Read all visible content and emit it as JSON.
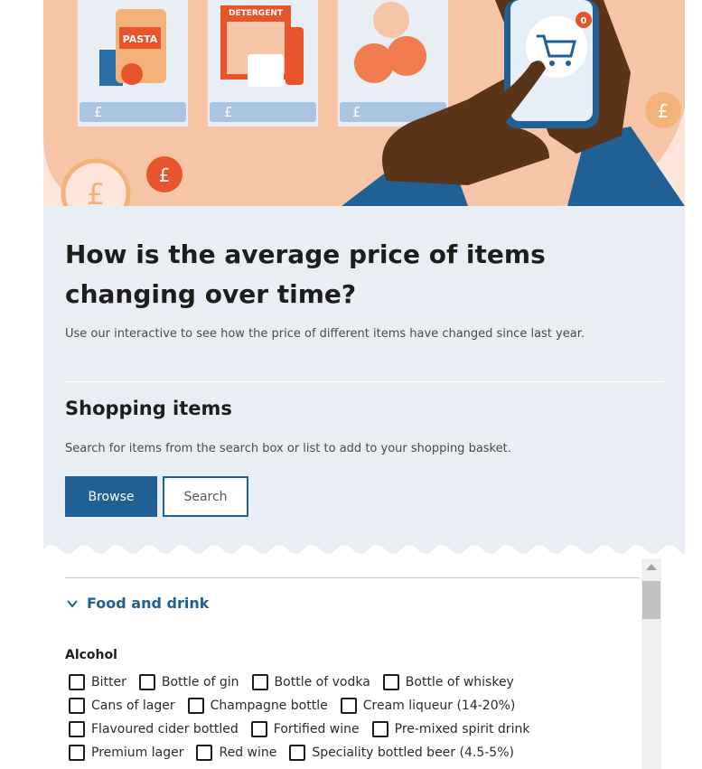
{
  "hero": {
    "pasta_label": "PASTA",
    "detergent_label": "DETERGENT",
    "price_symbol": "£",
    "cart_badge": "0"
  },
  "intro": {
    "title": "How is the average price of items changing over time?",
    "description": "Use our interactive to see how the price of different items have changed since last year."
  },
  "shopping": {
    "title": "Shopping items",
    "description": "Search for items from the search box or list to add to your shopping basket.",
    "browse_label": "Browse",
    "search_label": "Search"
  },
  "list": {
    "category": "Food and drink",
    "subcategory": "Alcohol",
    "rows": [
      [
        "Bitter",
        "Bottle of gin",
        "Bottle of vodka",
        "Bottle of whiskey"
      ],
      [
        "Cans of lager",
        "Champagne bottle",
        "Cream liqueur (14-20%)"
      ],
      [
        "Flavoured cider bottled",
        "Fortified wine",
        "Pre-mixed spirit drink"
      ],
      [
        "Premium lager",
        "Red wine",
        "Speciality bottled beer (4.5-5%)"
      ]
    ]
  },
  "colors": {
    "accent": "#206095",
    "panel_bg": "#e9eef5",
    "hero_peach": "#f6c4a6",
    "coin_orange": "#f07c50"
  },
  "icons": [
    "pound-coin-icon",
    "shopping-cart-icon",
    "chevron-down-icon",
    "scroll-up-icon"
  ]
}
